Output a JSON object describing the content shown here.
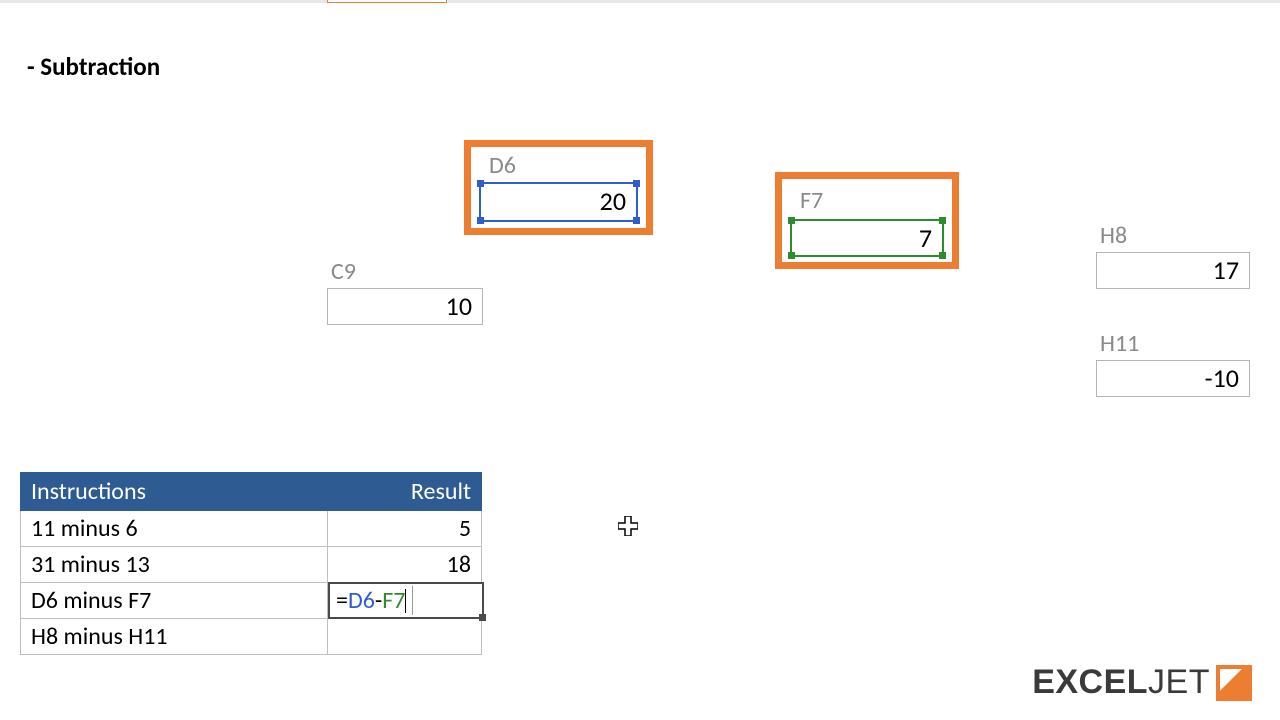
{
  "section_title": "- Subtraction",
  "cells": {
    "D6": {
      "label": "D6",
      "value": "20"
    },
    "F7": {
      "label": "F7",
      "value": "7"
    },
    "C9": {
      "label": "C9",
      "value": "10"
    },
    "H8": {
      "label": "H8",
      "value": "17"
    },
    "H11": {
      "label": "H11",
      "value": "-10"
    }
  },
  "table": {
    "headers": {
      "instructions": "Instructions",
      "result": "Result"
    },
    "rows": [
      {
        "instruction": "11 minus 6",
        "result": "5"
      },
      {
        "instruction": "31 minus 13",
        "result": "18"
      },
      {
        "instruction": "D6 minus F7",
        "result": ""
      },
      {
        "instruction": "H8 minus H11",
        "result": ""
      }
    ]
  },
  "editing": {
    "eq": "=",
    "ref1": "D6",
    "op": "-",
    "ref2": "F7"
  },
  "logo": {
    "part1": "EXCEL",
    "part2": "JET"
  }
}
